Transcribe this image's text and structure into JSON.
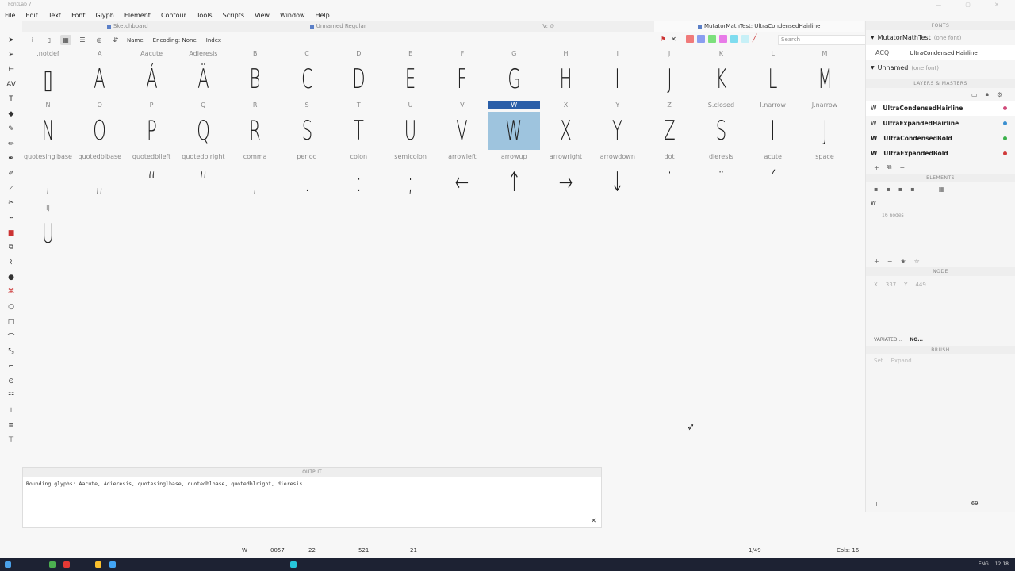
{
  "window": {
    "title": "FontLab 7"
  },
  "menu": [
    "File",
    "Edit",
    "Text",
    "Font",
    "Glyph",
    "Element",
    "Contour",
    "Tools",
    "Scripts",
    "View",
    "Window",
    "Help"
  ],
  "tabs": [
    "Sketchboard",
    "Unnamed Regular",
    "V: ⊙",
    "MutatorMathTest: UltraCondensedHairline"
  ],
  "toolbar": {
    "name_label": "Name",
    "encoding_label": "Encoding: None",
    "index_label": "Index",
    "search_placeholder": "Search"
  },
  "swatch_colors": [
    "#f07a7a",
    "#8a9ef0",
    "#7ce07c",
    "#e87be8",
    "#7fdcef",
    "#c7f0f7"
  ],
  "glyphs": [
    {
      "name": ".notdef",
      "char": "▯"
    },
    {
      "name": "A",
      "char": "A"
    },
    {
      "name": "Aacute",
      "char": "Á"
    },
    {
      "name": "Adieresis",
      "char": "Ä"
    },
    {
      "name": "B",
      "char": "B"
    },
    {
      "name": "C",
      "char": "C"
    },
    {
      "name": "D",
      "char": "D"
    },
    {
      "name": "E",
      "char": "E"
    },
    {
      "name": "F",
      "char": "F"
    },
    {
      "name": "G",
      "char": "G"
    },
    {
      "name": "H",
      "char": "H"
    },
    {
      "name": "I",
      "char": "I"
    },
    {
      "name": "J",
      "char": "J"
    },
    {
      "name": "K",
      "char": "K"
    },
    {
      "name": "L",
      "char": "L"
    },
    {
      "name": "M",
      "char": "M"
    },
    {
      "name": "N",
      "char": "N"
    },
    {
      "name": "O",
      "char": "O"
    },
    {
      "name": "P",
      "char": "P"
    },
    {
      "name": "Q",
      "char": "Q"
    },
    {
      "name": "R",
      "char": "R"
    },
    {
      "name": "S",
      "char": "S"
    },
    {
      "name": "T",
      "char": "T"
    },
    {
      "name": "U",
      "char": "U"
    },
    {
      "name": "V",
      "char": "V"
    },
    {
      "name": "W",
      "char": "W"
    },
    {
      "name": "X",
      "char": "X"
    },
    {
      "name": "Y",
      "char": "Y"
    },
    {
      "name": "Z",
      "char": "Z"
    },
    {
      "name": "S.closed",
      "char": "S"
    },
    {
      "name": "I.narrow",
      "char": "I"
    },
    {
      "name": "J.narrow",
      "char": "J"
    },
    {
      "name": "quotesinglbase",
      "char": "‚"
    },
    {
      "name": "quotedblbase",
      "char": "„"
    },
    {
      "name": "quotedblleft",
      "char": "“"
    },
    {
      "name": "quotedblright",
      "char": "”"
    },
    {
      "name": "comma",
      "char": ","
    },
    {
      "name": "period",
      "char": "."
    },
    {
      "name": "colon",
      "char": ":"
    },
    {
      "name": "semicolon",
      "char": ";"
    },
    {
      "name": "arrowleft",
      "char": "←"
    },
    {
      "name": "arrowup",
      "char": "↑"
    },
    {
      "name": "arrowright",
      "char": "→"
    },
    {
      "name": "arrowdown",
      "char": "↓"
    },
    {
      "name": "dot",
      "char": "˙"
    },
    {
      "name": "dieresis",
      "char": "¨"
    },
    {
      "name": "acute",
      "char": "´"
    },
    {
      "name": "space",
      "char": " "
    },
    {
      "name": "IJ",
      "char": "U"
    }
  ],
  "selected_glyph": "W",
  "panels": {
    "fonts": {
      "header": "FONTS",
      "font1_name": "MutatorMathTest",
      "font1_meta": "(one font)",
      "sample": "ACQ",
      "master": "UltraCondensed Hairline",
      "font2_name": "Unnamed",
      "font2_meta": "(one font)"
    },
    "layers": {
      "header": "LAYERS & MASTERS",
      "items": [
        {
          "name": "UltraCondensedHairline",
          "color": "#d04a7a"
        },
        {
          "name": "UltraExpandedHairline",
          "color": "#3a8fd0"
        },
        {
          "name": "UltraCondensedBold",
          "color": "#3ab04a"
        },
        {
          "name": "UltraExpandedBold",
          "color": "#d03a3a"
        }
      ]
    },
    "elements": {
      "header": "ELEMENTS",
      "item": "W",
      "sub": "16 nodes"
    },
    "node": {
      "header": "NODE",
      "x_label": "X",
      "x_value": "337",
      "y_label": "Y",
      "y_value": "449"
    },
    "tabs2": [
      "VARIATED...",
      "NO..."
    ],
    "brush": {
      "header": "BRUSH",
      "set": "Set",
      "expand": "Expand",
      "size": "69"
    }
  },
  "output": {
    "header": "OUTPUT",
    "text": "Rounding glyphs: Aacute, Adieresis, quotesinglbase, quotedblbase, quotedblright, dieresis"
  },
  "status": {
    "glyph": "W",
    "unicode": "0057",
    "lsb": "22",
    "width": "521",
    "rsb": "21",
    "page": "1/49",
    "cols": "Cols: 16"
  },
  "taskbar": {
    "lang": "ENG",
    "time": "12:18"
  }
}
